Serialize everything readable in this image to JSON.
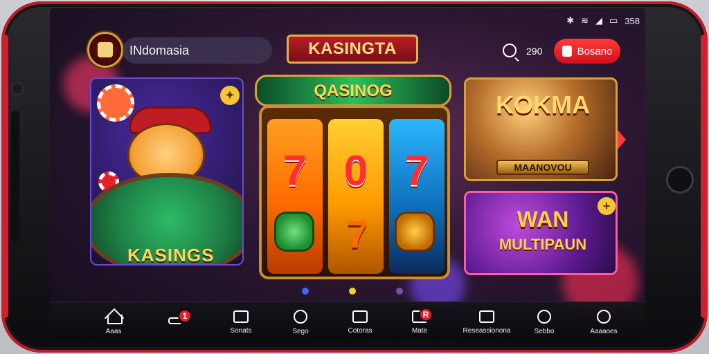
{
  "status": {
    "time": "358"
  },
  "header": {
    "username": "INdomasia",
    "brand": "KASINGTA",
    "points": "290",
    "bonus_label": "Bosano"
  },
  "cards": {
    "left": {
      "label": "KASINGS"
    },
    "middle": {
      "title": "QASINOG",
      "reels": [
        "7",
        "0",
        "7"
      ],
      "small": "7"
    },
    "top_right": {
      "title": "KOKMA",
      "ribbon": "MAANOVOU"
    },
    "bottom_right": {
      "title": "WAN",
      "subtitle": "MULTIPAUN"
    }
  },
  "nav": {
    "items": [
      {
        "label": "Aaas"
      },
      {
        "label": "",
        "badge": "1"
      },
      {
        "label": "Sonats"
      },
      {
        "label": "Sego"
      },
      {
        "label": "Cotoras"
      },
      {
        "label": "Mate",
        "badge": "R"
      },
      {
        "label": "Reseassionona"
      },
      {
        "label": "Sebbo"
      },
      {
        "label": "Aaaaoes"
      }
    ]
  },
  "colors": {
    "accent_red": "#d2101a",
    "accent_gold": "#e5b046"
  }
}
